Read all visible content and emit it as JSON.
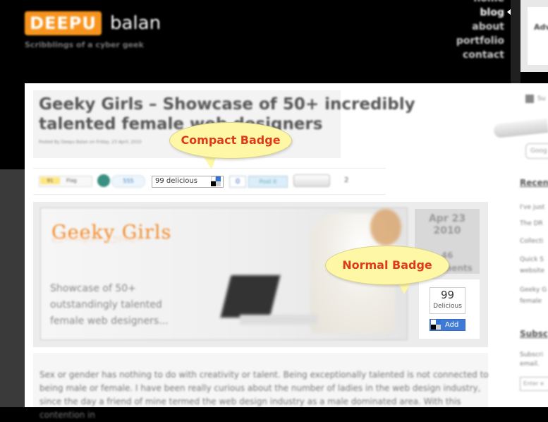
{
  "header": {
    "logo_box": "DEEPU",
    "logo_name": "balan",
    "tagline": "Scribblings of a cyber geek",
    "nav": [
      "home",
      "blog",
      "about",
      "portfolio",
      "contact"
    ],
    "active_nav": "blog",
    "sidebar_top_text": "Adv"
  },
  "post": {
    "title": "Geeky Girls – Showcase of 50+ incredibly talented female web designers",
    "byline": "Posted By Deepu Balan on Friday, 23 April, 2010"
  },
  "social": {
    "fb_count": "91",
    "fb_label": "Flag",
    "share_count": "555",
    "compact_badge_text": "99 delicious",
    "zero_count": "0",
    "post_button": "Post it",
    "row_count": "2"
  },
  "hero": {
    "title": "Geeky Girls",
    "reflection": "Geeky Girls",
    "subtitle": "Showcase of 50+ outstandingly talented female web designers..."
  },
  "date": {
    "month_day": "Apr 23",
    "year": "2010",
    "comments_count": "46",
    "comments_label": "Comments"
  },
  "normal_badge": {
    "count": "99",
    "label": "Delicious",
    "add_label": "Add"
  },
  "callouts": {
    "compact": "Compact Badge",
    "normal": "Normal Badge"
  },
  "body": {
    "text": "Sex or gender has nothing to do with creativity or talent. Being exceptionally talented is not connected to being male or female. I have been really curious about the number of ladies in the web design industry, since the day a friend of mine termed the web design industry as a male dominated area. With this contention in"
  },
  "sidebar": {
    "rss_text": "Su",
    "search_placeholder": "Goog",
    "recent_heading": "Recen",
    "recent_items": [
      "I've just",
      "The DR",
      "Collecti",
      "Quick S",
      "website",
      "Geeky G",
      "female"
    ],
    "subscribe_heading": "Subsc",
    "subscribe_text": [
      "Subscri",
      "email."
    ],
    "email_placeholder": "Enter e"
  },
  "colors": {
    "logo_orange": "#f7941d",
    "callout_fill": "#fdf7a6",
    "callout_text": "#e03a1a",
    "delicious_blue": "#3e7ad6"
  }
}
